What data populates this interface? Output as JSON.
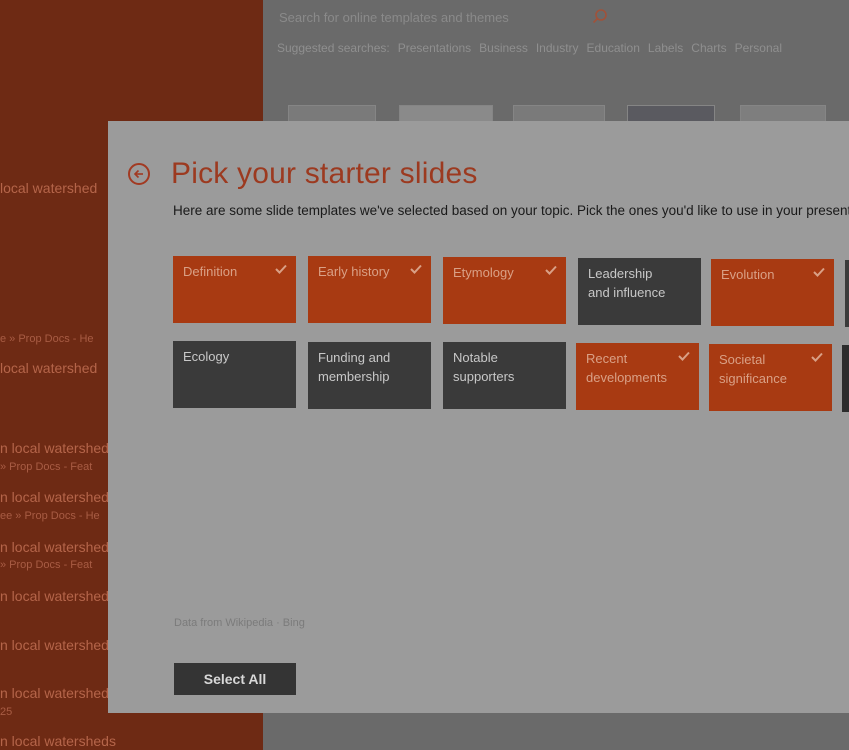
{
  "recent": {
    "items": [
      {
        "title": "local watershed",
        "path": ""
      },
      {
        "title": "local watershed",
        "path": "e » Prop Docs - He"
      },
      {
        "title": "n local watershed",
        "path": "» Prop Docs - Feat"
      },
      {
        "title": "n local watershed",
        "path": "ee » Prop Docs - He"
      },
      {
        "title": "n local watershed",
        "path": "» Prop Docs - Feat"
      },
      {
        "title": "n local watershed",
        "path": ""
      },
      {
        "title": "n local watershed",
        "path": ""
      },
      {
        "title": "n local watershed",
        "path": "25"
      },
      {
        "title": "n local watersheds",
        "path": ""
      }
    ]
  },
  "search": {
    "placeholder": "Search for online templates and themes",
    "suggested_label": "Suggested searches:",
    "suggestions": [
      "Presentations",
      "Business",
      "Industry",
      "Education",
      "Labels",
      "Charts",
      "Personal"
    ]
  },
  "dialog": {
    "title": "Pick your starter slides",
    "description": "Here are some slide templates we've selected based on your topic. Pick the ones you'd like to use in your presentation.",
    "tiles": [
      {
        "label": "Definition",
        "selected": true
      },
      {
        "label": "Early history",
        "selected": true
      },
      {
        "label": "Etymology",
        "selected": true
      },
      {
        "label": "Leadership and influence",
        "selected": false
      },
      {
        "label": "Evolution",
        "selected": true
      },
      {
        "label": "Ecology",
        "selected": false
      },
      {
        "label": "Funding and membership",
        "selected": false
      },
      {
        "label": "Notable supporters",
        "selected": false
      },
      {
        "label": "Recent developments",
        "selected": true
      },
      {
        "label": "Societal significance",
        "selected": true
      }
    ],
    "attribution": "Data from Wikipedia · Bing",
    "select_all_label": "Select All"
  },
  "colors": {
    "selected_tile": "#a83a12",
    "unselected_tile": "#3a3a3a",
    "accent": "#9c3a20"
  },
  "icons": {
    "back": "back-arrow-circle-icon",
    "search": "search-icon",
    "check": "checkmark-icon"
  }
}
